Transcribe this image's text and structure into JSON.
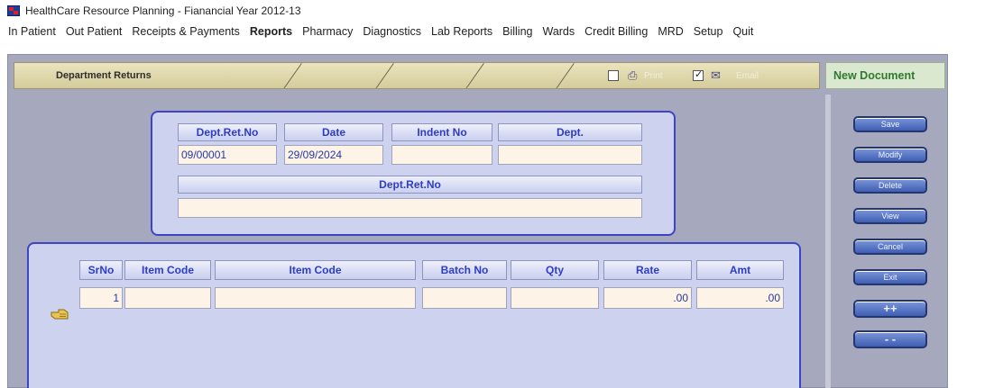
{
  "window": {
    "title": "HealthCare Resource Planning - Fianancial Year 2012-13"
  },
  "menu": [
    {
      "label": "In Patient",
      "bold": false
    },
    {
      "label": "Out Patient",
      "bold": false
    },
    {
      "label": "Receipts & Payments",
      "bold": false
    },
    {
      "label": "Reports",
      "bold": true
    },
    {
      "label": "Pharmacy",
      "bold": false
    },
    {
      "label": "Diagnostics",
      "bold": false
    },
    {
      "label": "Lab Reports",
      "bold": false
    },
    {
      "label": "Billing",
      "bold": false
    },
    {
      "label": "Wards",
      "bold": false
    },
    {
      "label": "Credit Billing",
      "bold": false
    },
    {
      "label": "MRD",
      "bold": false
    },
    {
      "label": "Setup",
      "bold": false
    },
    {
      "label": "Quit",
      "bold": false
    }
  ],
  "header": {
    "title": "Department Returns",
    "print_label": "Print",
    "email_label": "Email",
    "print_checked": false,
    "email_checked": true,
    "status": "New Document"
  },
  "form": {
    "dept_ret_no_label": "Dept.Ret.No",
    "date_label": "Date",
    "indent_no_label": "Indent No",
    "dept_label": "Dept.",
    "dept_ret_no_value": "09/00001",
    "date_value": "29/09/2024",
    "indent_no_value": "",
    "dept_value": "",
    "dept_ret_no_label_2": "Dept.Ret.No",
    "dept_ret_no_value_2": ""
  },
  "grid": {
    "headers": {
      "srno": "SrNo",
      "item_code": "Item Code",
      "item_name": "Item Code",
      "batch_no": "Batch No",
      "qty": "Qty",
      "rate": "Rate",
      "amt": "Amt"
    },
    "rows": [
      {
        "srno": "1",
        "item_code": "",
        "item_name": "",
        "batch_no": "",
        "qty": "",
        "rate": ".00",
        "amt": ".00"
      }
    ]
  },
  "buttons": {
    "save": "Save",
    "modify": "Modify",
    "delete": "Delete",
    "view": "View",
    "cancel": "Cancel",
    "exit": "Exit",
    "add_row": "++",
    "remove_row": "- -"
  },
  "colors": {
    "panel_border": "#3d44c9",
    "panel_bg": "#cdd3ef",
    "header_text": "#2e3cc8",
    "new_document": "#2e7a2e",
    "main_bg": "#a6a9bd"
  }
}
